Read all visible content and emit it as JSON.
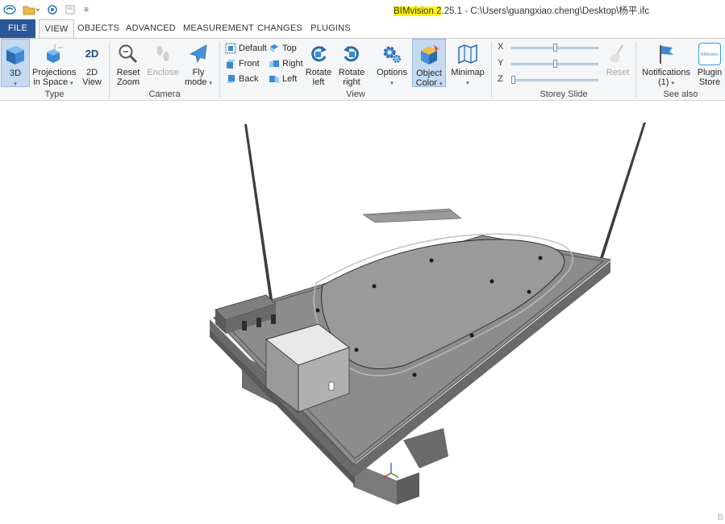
{
  "titlebar": {
    "app_name": "BIMvision 2",
    "title_rest": ".25.1 - C:\\Users\\guangxiao.cheng\\Desktop\\杨平.ifc",
    "quick_access_caret": "≡"
  },
  "tabs": [
    {
      "label": "FILE"
    },
    {
      "label": "VIEW"
    },
    {
      "label": "OBJECTS"
    },
    {
      "label": "ADVANCED"
    },
    {
      "label": "MEASUREMENT"
    },
    {
      "label": "CHANGES"
    },
    {
      "label": "PLUGINS"
    }
  ],
  "ribbon": {
    "type_group": {
      "label": "Type",
      "btn_3d": "3D",
      "btn_projections_1": "Projections",
      "btn_projections_2": "in Space",
      "btn_2d_1": "2D",
      "btn_2d_2": "View",
      "icon_2d_text": "2D"
    },
    "camera_group": {
      "label": "Camera",
      "reset_zoom_1": "Reset",
      "reset_zoom_2": "Zoom",
      "enclose": "Enclose",
      "fly_1": "Fly",
      "fly_2": "mode"
    },
    "view_group": {
      "label": "View",
      "default": "Default",
      "front": "Front",
      "back": "Back",
      "top": "Top",
      "right": "Right",
      "left": "Left",
      "rotate_left_1": "Rotate",
      "rotate_left_2": "left",
      "rotate_right_1": "Rotate",
      "rotate_right_2": "right",
      "options": "Options",
      "object_color_1": "Object",
      "object_color_2": "Color",
      "minimap": "Minimap"
    },
    "storey_group": {
      "label": "Storey Slide",
      "x": "X",
      "y": "Y",
      "z": "Z",
      "x_value": 0.5,
      "y_value": 0.5,
      "z_value": 0.0,
      "reset": "Reset"
    },
    "seealso_group": {
      "label": "See also",
      "notifications_1": "Notifications",
      "notifications_2": "(1)",
      "plugin_store_1": "Plugin",
      "plugin_store_2": "Store",
      "plugin_store_logo": "BIMvision"
    }
  },
  "viewport": {
    "watermark": "B"
  },
  "colors": {
    "file_tab": "#2b579a",
    "ribbon_bg": "#f5f6f7",
    "selected_btn": "#c5d9f1",
    "title_highlight": "#fff200",
    "model_slab": "#8a8a8a",
    "model_side": "#6a6a6a"
  }
}
